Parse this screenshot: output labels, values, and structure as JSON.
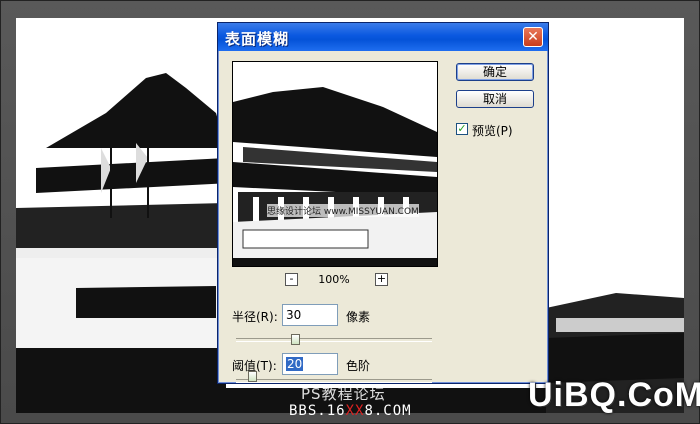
{
  "dialog": {
    "title": "表面模糊",
    "close_glyph": "✕",
    "ok_label": "确定",
    "cancel_label": "取消",
    "preview_checkbox": {
      "label": "预览(P)",
      "checked": true,
      "check_glyph": "✓"
    },
    "preview_watermark": "思缘设计论坛 www.MISSYUAN.COM",
    "zoom": {
      "level": "100%",
      "minus": "-",
      "plus": "+"
    },
    "radius": {
      "label": "半径(R):",
      "value": "30",
      "unit": "像素",
      "slider_fraction": 0.3
    },
    "threshold": {
      "label": "阈值(T):",
      "value": "20",
      "unit": "色阶",
      "slider_fraction": 0.08
    }
  },
  "watermarks": {
    "forum": "PS教程论坛",
    "bbs_prefix": "BBS.16",
    "bbs_red": "XX",
    "bbs_suffix": "8.COM",
    "brand": "UiBQ.CoM"
  },
  "colors": {
    "titlebar": "#0a58e0",
    "dialog_bg": "#ece9d8",
    "checkbox_mark": "#21a121"
  }
}
